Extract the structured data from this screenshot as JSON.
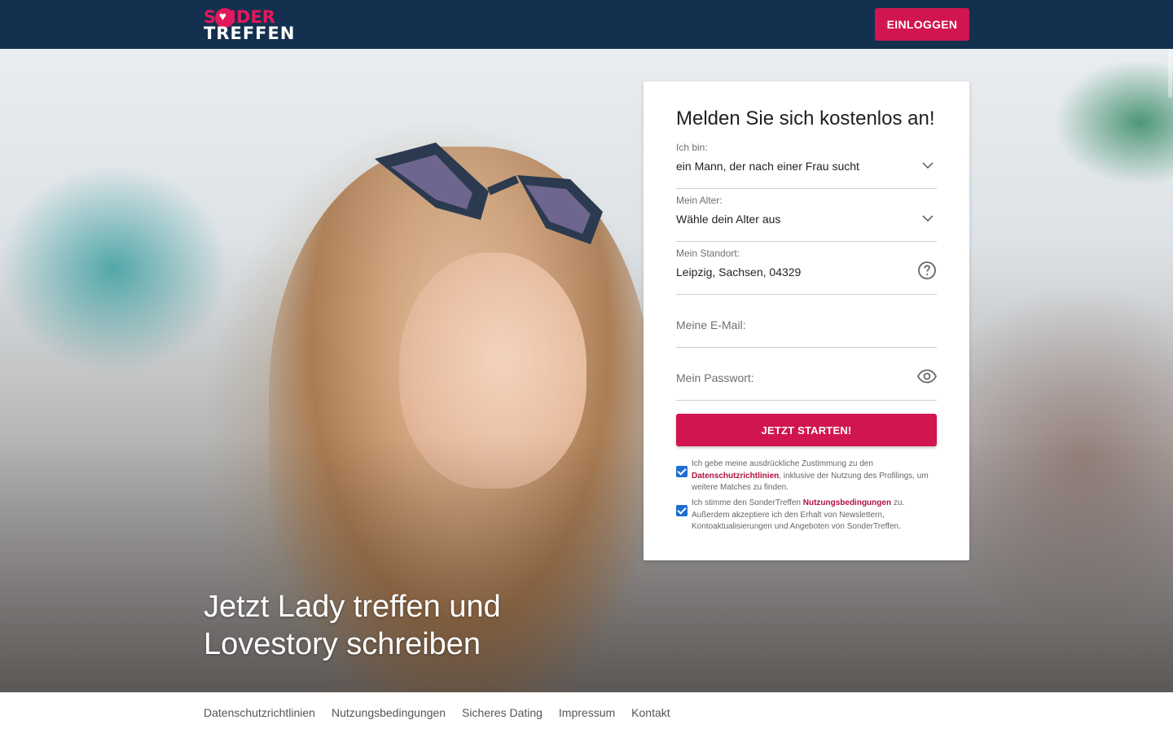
{
  "brand": {
    "logo_line1": "S  NDER",
    "logo_line2": "TREFFEN",
    "brand_color": "#d1154f",
    "header_color": "#14304f"
  },
  "header": {
    "login_label": "EINLOGGEN"
  },
  "hero": {
    "title_line1": "Jetzt Lady treffen und",
    "title_line2": "Lovestory schreiben"
  },
  "form": {
    "title": "Melden Sie sich kostenlos an!",
    "gender": {
      "label": "Ich bin:",
      "value": "ein Mann, der nach einer Frau sucht",
      "icon": "chevron-down-icon"
    },
    "age": {
      "label": "Mein Alter:",
      "value": "Wähle dein Alter aus",
      "icon": "chevron-down-icon"
    },
    "location": {
      "label": "Mein Standort:",
      "value": "Leipzig, Sachsen, 04329",
      "icon": "help-circle-icon"
    },
    "email": {
      "placeholder": "Meine E-Mail:"
    },
    "password": {
      "placeholder": "Mein Passwort:",
      "icon": "eye-icon"
    },
    "submit_label": "JETZT STARTEN!",
    "consent_privacy": {
      "checked": true,
      "text_before": "Ich gebe meine ausdrückliche Zustimmung zu den ",
      "link": "Datenschutzrichtlinien",
      "text_after": ", inklusive der Nutzung des Profilings, um weitere Matches zu finden."
    },
    "consent_terms": {
      "checked": true,
      "text_before": "Ich stimme den SonderTreffen ",
      "link": "Nutzungsbedingungen",
      "text_after": " zu. Außerdem akzeptiere ich den Erhalt von Newslettern, Kontoaktualisierungen und Angeboten von SonderTreffen."
    }
  },
  "footer": {
    "links": [
      "Datenschutzrichtlinien",
      "Nutzungsbedingungen",
      "Sicheres Dating",
      "Impressum",
      "Kontakt"
    ]
  }
}
